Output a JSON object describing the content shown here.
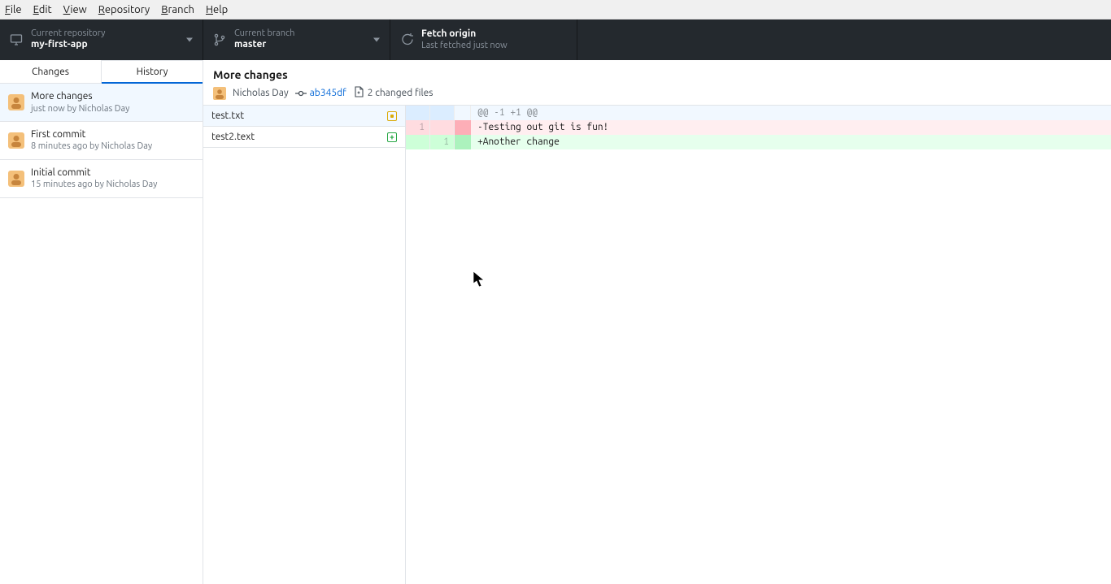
{
  "menu": {
    "file": "File",
    "edit": "Edit",
    "view": "View",
    "repository": "Repository",
    "branch": "Branch",
    "help": "Help"
  },
  "toolbar": {
    "repo_label": "Current repository",
    "repo_value": "my-first-app",
    "branch_label": "Current branch",
    "branch_value": "master",
    "fetch_label": "Fetch origin",
    "fetch_value": "Last fetched just now"
  },
  "tabs": {
    "changes": "Changes",
    "history": "History"
  },
  "commits": [
    {
      "title": "More changes",
      "meta": "just now by Nicholas Day"
    },
    {
      "title": "First commit",
      "meta": "8 minutes ago by Nicholas Day"
    },
    {
      "title": "Initial commit",
      "meta": "15 minutes ago by Nicholas Day"
    }
  ],
  "detail": {
    "title": "More changes",
    "author": "Nicholas Day",
    "sha": "ab345df",
    "changed_label": "2 changed files"
  },
  "files": [
    {
      "name": "test.txt",
      "status": "mod"
    },
    {
      "name": "test2.text",
      "status": "add"
    }
  ],
  "diff": {
    "hunk": "@@ -1 +1 @@",
    "del_line_no": "1",
    "del_text": "-Testing out git is fun!",
    "add_line_no": "1",
    "add_text": "+Another change"
  }
}
